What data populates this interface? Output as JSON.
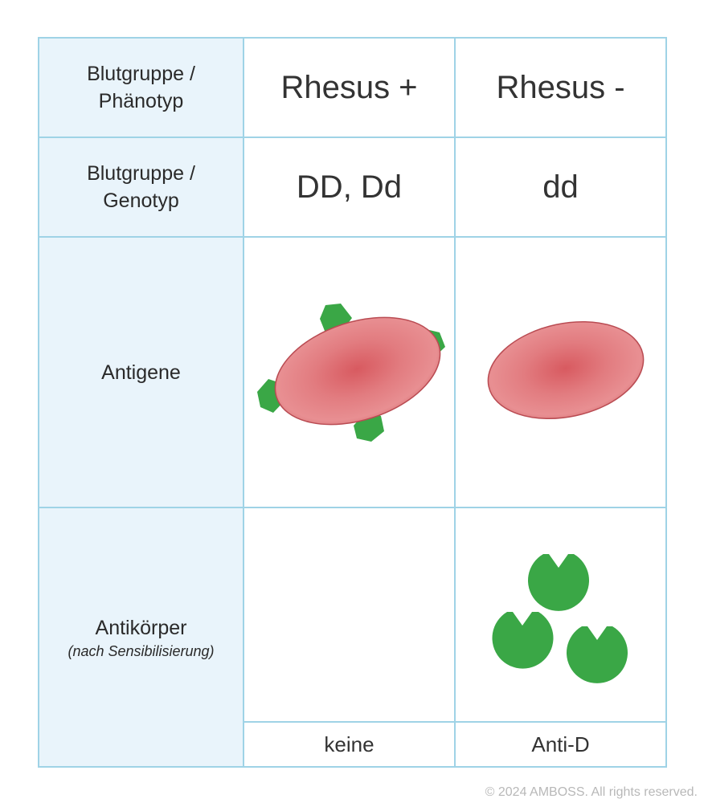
{
  "table": {
    "rows": [
      {
        "label": [
          "Blutgruppe /",
          "Phänotyp"
        ],
        "rh_pos": "Rhesus +",
        "rh_neg": "Rhesus -"
      },
      {
        "label": [
          "Blutgruppe /",
          "Genotyp"
        ],
        "rh_pos": "DD, Dd",
        "rh_neg": "dd"
      },
      {
        "label": [
          "Antigene"
        ],
        "rh_pos_icon": "red-blood-cell-with-d-antigens-icon",
        "rh_neg_icon": "red-blood-cell-icon"
      },
      {
        "label": [
          "Antikörper"
        ],
        "sublabel": "(nach Sensibilisierung)",
        "rh_pos_icon": "",
        "rh_neg_icon": "anti-d-antibody-icon",
        "rh_pos_caption": "keine",
        "rh_neg_caption": "Anti-D"
      }
    ]
  },
  "colors": {
    "border": "#9fd3e6",
    "label_background": "#e9f4fb",
    "cell_red": "#d96469",
    "antigen_green": "#3aa746"
  },
  "copyright": "© 2024 AMBOSS. All rights reserved."
}
